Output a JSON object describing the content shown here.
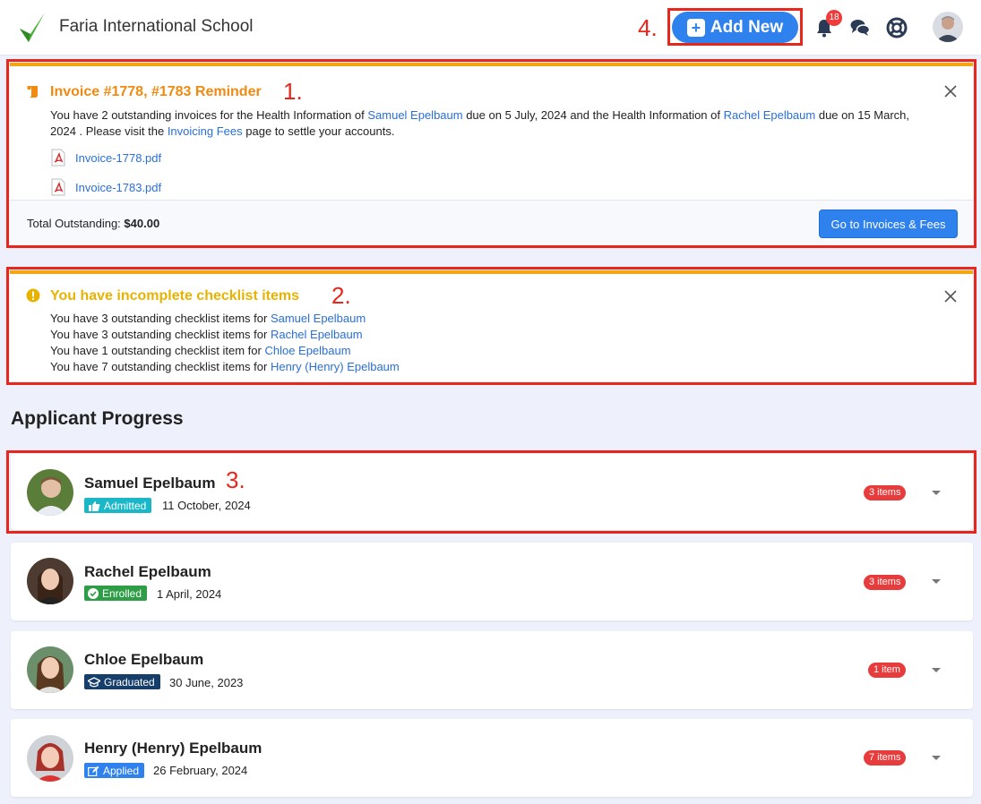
{
  "header": {
    "school_name": "Faria International School",
    "add_new_label": "Add New",
    "notification_count": "18",
    "annotation": "4."
  },
  "invoice_alert": {
    "annotation": "1.",
    "title": "Invoice #1778, #1783 Reminder",
    "text_1": "You have 2 outstanding invoices for the Health Information of ",
    "link_1": "Samuel Epelbaum",
    "text_2": " due on 5 July, 2024 and the Health Information of ",
    "link_2": "Rachel Epelbaum",
    "text_3": " due on 15 March, 2024 . Please visit the ",
    "link_3": "Invoicing Fees",
    "text_4": " page to settle your accounts.",
    "files": [
      "Invoice-1778.pdf",
      "Invoice-1783.pdf"
    ],
    "total_label": "Total Outstanding: ",
    "total_value": "$40.00",
    "button_label": "Go to Invoices & Fees"
  },
  "checklist_alert": {
    "annotation": "2.",
    "title": "You have incomplete checklist items",
    "lines": [
      {
        "text": "You have 3 outstanding checklist items for ",
        "link": "Samuel Epelbaum"
      },
      {
        "text": "You have 3 outstanding checklist items for ",
        "link": "Rachel Epelbaum"
      },
      {
        "text": "You have 1 outstanding checklist item for ",
        "link": "Chloe Epelbaum"
      },
      {
        "text": "You have 7 outstanding checklist items for ",
        "link": "Henry (Henry) Epelbaum"
      }
    ]
  },
  "progress": {
    "title": "Applicant Progress",
    "annotation": "3.",
    "applicants": [
      {
        "name": "Samuel Epelbaum",
        "status": "Admitted",
        "date": "11 October, 2024",
        "items": "3 items",
        "status_color": "#1ab7c9"
      },
      {
        "name": "Rachel Epelbaum",
        "status": "Enrolled",
        "date": "1 April, 2024",
        "items": "3 items",
        "status_color": "#2e9e46"
      },
      {
        "name": "Chloe Epelbaum",
        "status": "Graduated",
        "date": "30 June, 2023",
        "items": "1 item",
        "status_color": "#153e6b"
      },
      {
        "name": "Henry (Henry) Epelbaum",
        "status": "Applied",
        "date": "26 February, 2024",
        "items": "7 items",
        "status_color": "#2f82ee"
      }
    ]
  },
  "colors": {
    "accent": "#2f82ee",
    "annotation_red": "#e8261b",
    "warning_orange": "#f08a10",
    "warning_yellow": "#e8b300",
    "badge_red": "#e83b3b"
  }
}
